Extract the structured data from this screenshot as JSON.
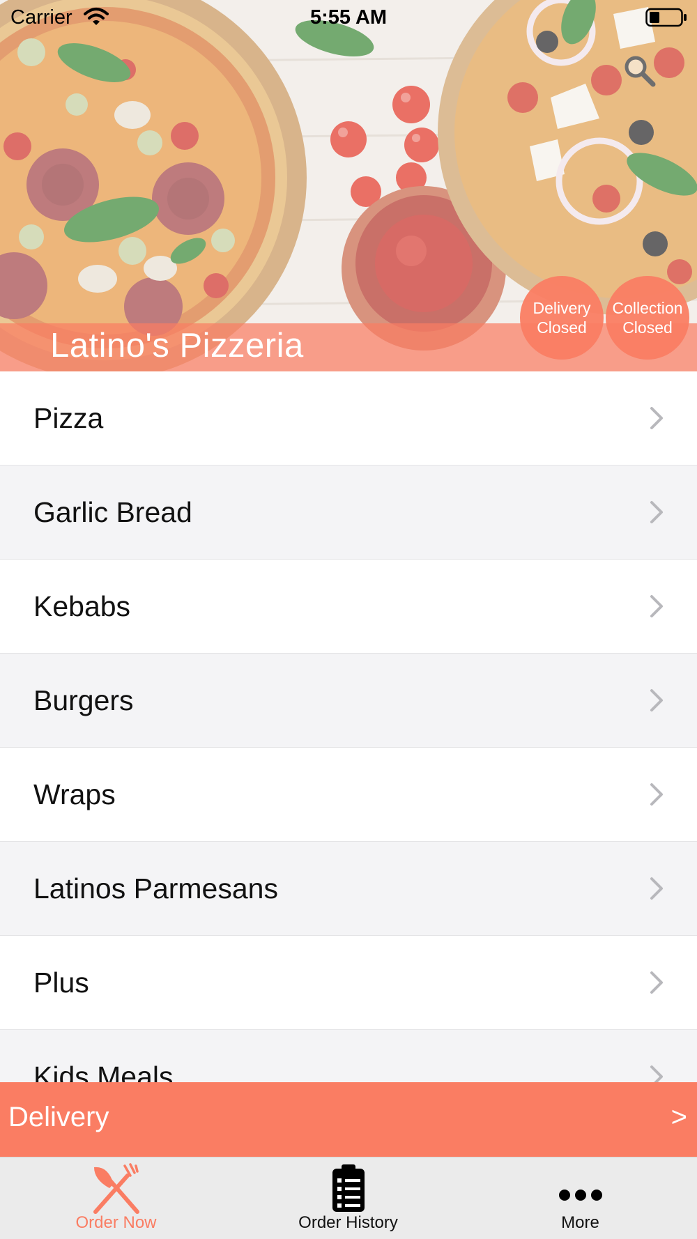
{
  "status_bar": {
    "carrier": "Carrier",
    "time": "5:55 AM",
    "icons": [
      "wifi-icon",
      "battery-icon"
    ]
  },
  "header": {
    "restaurant_name": "Latino's Pizzeria",
    "search_icon": "search-icon",
    "badges": {
      "delivery": {
        "line1": "Delivery",
        "line2": "Closed"
      },
      "collection": {
        "line1": "Collection",
        "line2": "Closed"
      }
    }
  },
  "menu": {
    "items": [
      {
        "label": "Pizza"
      },
      {
        "label": "Garlic Bread"
      },
      {
        "label": "Kebabs"
      },
      {
        "label": "Burgers"
      },
      {
        "label": "Wraps"
      },
      {
        "label": "Latinos Parmesans"
      },
      {
        "label": "Plus"
      },
      {
        "label": "Kids Meals"
      }
    ]
  },
  "delivery_bar": {
    "label": "Delivery",
    "arrow": ">"
  },
  "tab_bar": {
    "tabs": [
      {
        "label": "Order Now",
        "icon": "fork-knife-icon",
        "active": true
      },
      {
        "label": "Order History",
        "icon": "clipboard-list-icon",
        "active": false
      },
      {
        "label": "More",
        "icon": "more-dots-icon",
        "active": false
      }
    ]
  },
  "colors": {
    "accent": "#fa7d63",
    "row_alt": "#f4f4f6",
    "tab_bar_bg": "#ebebeb"
  }
}
